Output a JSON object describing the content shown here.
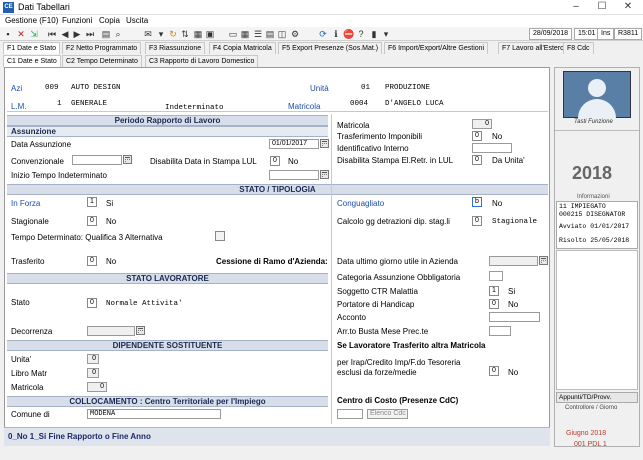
{
  "window": {
    "title": "Dati Tabellari",
    "app_icon": "CE"
  },
  "menu": [
    "Gestione (F10)",
    "Funzioni",
    "Copia",
    "Uscita"
  ],
  "status": {
    "date": "28/09/2018",
    "time": "15:01",
    "ins": "Ins",
    "code": "R3811"
  },
  "tabs_row1": [
    "F1 Date e Stato",
    "F2 Netto Programmato",
    "F3 Riassunzione",
    "F4 Copia Matricola",
    "F5 Export Presenze (Sos.Mat.)",
    "F6 Import/Export/Altre Gestioni",
    "F7 Lavoro all'Estero",
    "F8 Cdc"
  ],
  "tabs_row2": [
    "C1 Date e Stato",
    "C2 Tempo Determinato",
    "C3 Rapporto di Lavoro Domestico"
  ],
  "azienda": {
    "label": "Azi",
    "code": "009",
    "name": "AUTO DESIGN",
    "unita_label": "Unità",
    "unita_code": "01",
    "unita_name": "PRODUZIONE"
  },
  "livello": {
    "label": "L.M.",
    "code": "1",
    "name": "GENERALE",
    "tipo": "Indeterminato",
    "matricola_label": "Matricola",
    "matricola_code": "0004",
    "dipendente": "D'ANGELO LUCA"
  },
  "periodo": {
    "title": "Periodo Rapporto di Lavoro",
    "assunzione_title": "Assunzione",
    "data_assunzione_label": "Data Assunzione",
    "data_assunzione": "01/01/2017",
    "convenzionale_label": "Convenzionale",
    "disab_lul_label": "Disabilita Data in Stampa LUL",
    "disab_lul_value": "0",
    "disab_lul_text": "No",
    "inizio_td_label": "Inizio Tempo Indeterminato"
  },
  "right_top": {
    "matricola_label": "Matricola",
    "matricola_value": "0",
    "trasf_label": "Trasferimento Imponibili",
    "trasf_value": "0",
    "trasf_text": "No",
    "ident_label": "Identificativo Interno",
    "disab_retr_label": "Disabilita Stampa El.Retr. in LUL",
    "disab_retr_value": "0",
    "disab_retr_text": "Da Unita'"
  },
  "stato_tipologia": {
    "title": "STATO / TIPOLOGIA",
    "in_forza_label": "In Forza",
    "in_forza_value": "1",
    "in_forza_text": "Si",
    "stagionale_label": "Stagionale",
    "stagionale_value": "0",
    "stagionale_text": "No",
    "td_qual_label": "Tempo Determinato: Qualifica 3 Alternativa",
    "trasferito_label": "Trasferito",
    "trasferito_value": "0",
    "trasferito_text": "No",
    "cessione_label": "Cessione di Ramo d'Azienda:",
    "conguagliato_label": "Conguagliato",
    "conguagliato_value": "b",
    "conguagliato_text": "No",
    "calcolo_gg_label": "Calcolo gg detrazioni dip. stag.li",
    "calcolo_gg_value": "0",
    "calcolo_gg_text": "Stagionale",
    "ultimo_giorno_label": "Data ultimo giorno utile in Azienda"
  },
  "stato_lavoratore": {
    "title": "STATO    LAVORATORE",
    "stato_label": "Stato",
    "stato_value": "0",
    "stato_text": "Normale Attivita'",
    "decorrenza_label": "Decorrenza",
    "categoria_label": "Categoria Assunzione Obbligatoria",
    "ctr_label": "Soggetto CTR Malattia",
    "ctr_value": "1",
    "ctr_text": "Si",
    "handicap_label": "Portatore di Handicap",
    "handicap_value": "0",
    "handicap_text": "No",
    "acconto_label": "Acconto",
    "arr_label": "Arr.to Busta Mese Prec.te"
  },
  "dipendente_sost": {
    "title": "DIPENDENTE   SOSTITUENTE",
    "unita_label": "Unita'",
    "unita_value": "0",
    "libro_label": "Libro Matr",
    "libro_value": "0",
    "matricola_label": "Matricola",
    "matricola_value": "0"
  },
  "trasferito_matricola": {
    "title": "Se Lavoratore Trasferito altra Matricola",
    "irap_label_1": "per Irap/Credito Imp/F.do Tesoreria",
    "irap_label_2": "esclusi da forze/medie",
    "irap_value": "0",
    "irap_text": "No"
  },
  "collocamento": {
    "title": "COLLOCAMENTO : Centro Territoriale per l'Impiego",
    "comune_label": "Comune di",
    "comune_value": "MODENA"
  },
  "cdc": {
    "title": "Centro di Costo (Presenze CdC)",
    "elenco_label": "Elenco Cdc"
  },
  "footer_hint": "0_No  1_Si Fine Rapporto o Fine Anno",
  "side": {
    "photo_label": "Tasti Funzione",
    "year": "2018",
    "info_label": "Informazioni",
    "info_lines": [
      "11   IMPIEGATO",
      "000215 DISEGNATOR",
      "Avviato 01/01/2017",
      "Risolto 25/05/2018"
    ],
    "appunti_label": "Appunti/TD/Provv.",
    "controllore_label": "Controllore / Giorno",
    "month": "Giugno   2018",
    "pdl": "001 PDL 1"
  },
  "colors": {
    "header_bg": "#d7deea",
    "blue_label": "#1c4ea8",
    "red_text": "#c0392b"
  }
}
